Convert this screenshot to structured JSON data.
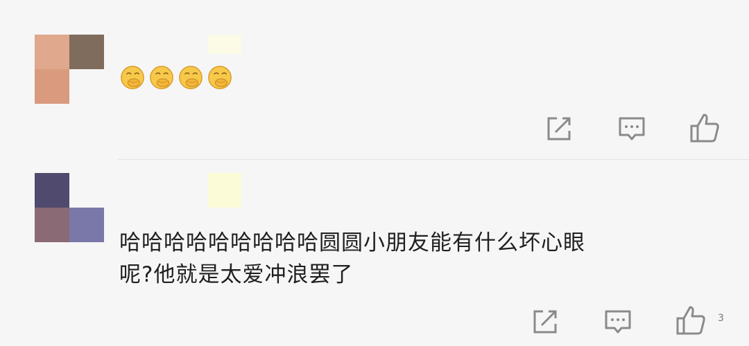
{
  "comments": [
    {
      "avatar_colors": [
        "#e0a88c",
        "#7f6c5c",
        "#d99a7e",
        "#f6f6f6"
      ],
      "emojis": [
        "laughing-hand-over-mouth-emoji",
        "laughing-hand-over-mouth-emoji",
        "laughing-hand-over-mouth-emoji",
        "laughing-hand-over-mouth-emoji"
      ],
      "actions": {
        "share": "share-icon",
        "reply": "comment-icon",
        "like": "thumbs-up-icon"
      }
    },
    {
      "avatar_colors": [
        "#4f4a6e",
        "#f6f6f6",
        "#8a6a75",
        "#7a78a8"
      ],
      "text_line1": "哈哈哈哈哈哈哈哈哈圆圆小朋友能有什么坏心眼",
      "text_line2": "呢?他就是太爱冲浪罢了",
      "like_count": "3",
      "actions": {
        "share": "share-icon",
        "reply": "comment-icon",
        "like": "thumbs-up-icon"
      }
    }
  ],
  "colors": {
    "background": "#f6f6f6",
    "icon": "#8a8a8a",
    "text": "#1f1f1f"
  }
}
